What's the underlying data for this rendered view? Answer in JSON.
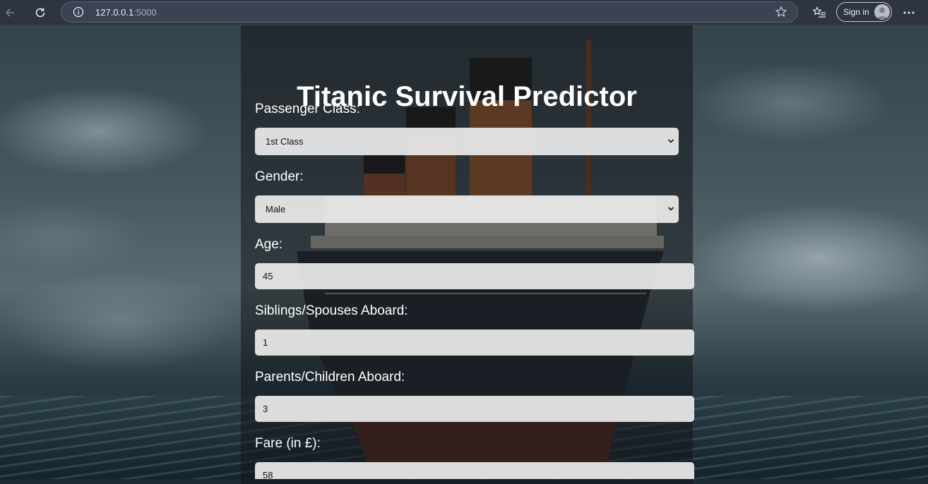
{
  "browser": {
    "url_host": "127.0.0.1",
    "url_port": ":5000",
    "signin_label": "Sign in"
  },
  "form": {
    "title": "Titanic Survival Predictor",
    "fields": [
      {
        "label": "Passenger Class:",
        "value": "1st Class"
      },
      {
        "label": "Gender:",
        "value": "Male"
      },
      {
        "label": "Age:",
        "value": "45"
      },
      {
        "label": "Siblings/Spouses Aboard:",
        "value": "1"
      },
      {
        "label": "Parents/Children Aboard:",
        "value": "3"
      },
      {
        "label": "Fare (in £):",
        "value": "58"
      }
    ]
  }
}
